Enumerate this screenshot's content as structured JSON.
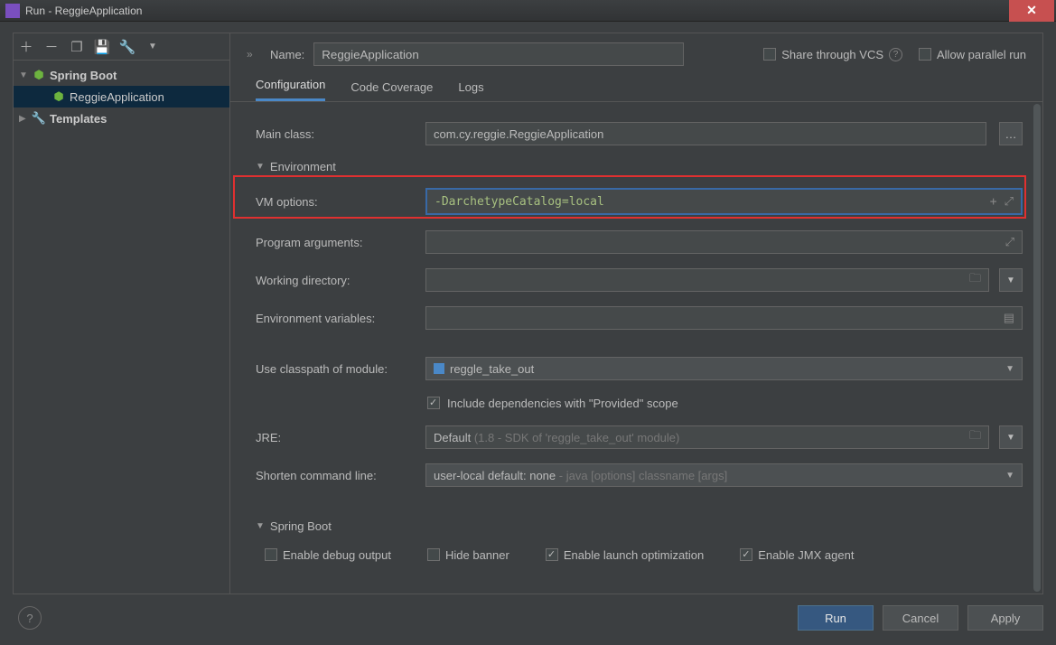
{
  "window": {
    "title": "Run - ReggieApplication"
  },
  "header": {
    "name_label": "Name:",
    "name_value": "ReggieApplication",
    "share_vcs": "Share through VCS",
    "allow_parallel": "Allow parallel run"
  },
  "sidebar": {
    "items": [
      {
        "label": "Spring Boot",
        "bold": true
      },
      {
        "label": "ReggieApplication"
      },
      {
        "label": "Templates",
        "bold": true
      }
    ]
  },
  "tabs": [
    {
      "label": "Configuration"
    },
    {
      "label": "Code Coverage"
    },
    {
      "label": "Logs"
    }
  ],
  "form": {
    "main_class_label": "Main class:",
    "main_class_value": "com.cy.reggie.ReggieApplication",
    "env_section": "Environment",
    "vm_label": "VM options:",
    "vm_value": "-DarchetypeCatalog=local",
    "prog_args_label": "Program arguments:",
    "work_dir_label": "Working directory:",
    "env_vars_label": "Environment variables:",
    "classpath_label": "Use classpath of module:",
    "classpath_value": "reggle_take_out",
    "include_provided": "Include dependencies with \"Provided\" scope",
    "jre_label": "JRE:",
    "jre_value_prefix": "Default",
    "jre_value_dim": "(1.8 - SDK of 'reggle_take_out' module)",
    "shorten_label": "Shorten command line:",
    "shorten_value_prefix": "user-local default: none",
    "shorten_value_dim": "- java [options] classname [args]",
    "springboot_section": "Spring Boot",
    "cb_debug": "Enable debug output",
    "cb_hide_banner": "Hide banner",
    "cb_launch_opt": "Enable launch optimization",
    "cb_jmx": "Enable JMX agent"
  },
  "footer": {
    "run": "Run",
    "cancel": "Cancel",
    "apply": "Apply"
  }
}
